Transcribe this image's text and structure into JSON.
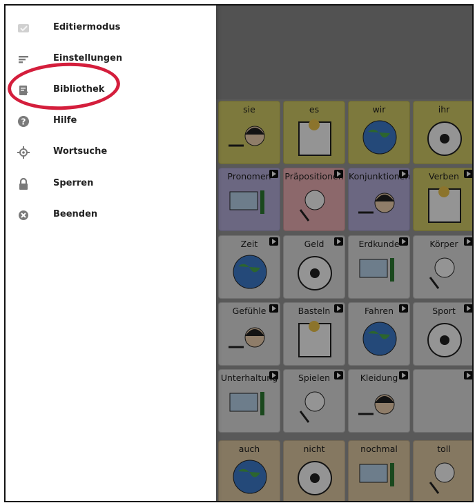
{
  "drawer": {
    "items": [
      {
        "label": "Editiermodus",
        "icon": "edit-mode-icon"
      },
      {
        "label": "Einstellungen",
        "icon": "settings-icon"
      },
      {
        "label": "Bibliothek",
        "icon": "library-icon"
      },
      {
        "label": "Hilfe",
        "icon": "help-icon"
      },
      {
        "label": "Wortsuche",
        "icon": "word-search-icon"
      },
      {
        "label": "Sperren",
        "icon": "lock-icon"
      },
      {
        "label": "Beenden",
        "icon": "close-icon"
      }
    ],
    "highlighted_item": "Bibliothek"
  },
  "board": {
    "rows": [
      [
        {
          "label": "sie",
          "color": "#d8d06a"
        },
        {
          "label": "es",
          "color": "#d8d06a"
        },
        {
          "label": "wir",
          "color": "#d8d06a"
        },
        {
          "label": "ihr",
          "color": "#d8d06a"
        }
      ],
      [
        {
          "label": "Pronomen",
          "color": "#b8b2de"
        },
        {
          "label": "Präpositionen",
          "color": "#f2b3b8"
        },
        {
          "label": "Konjunktionen",
          "color": "#b8b2de"
        },
        {
          "label": "Verben",
          "color": "#d8d06a"
        }
      ],
      [
        {
          "label": "Zeit",
          "color": "#e4e4e4"
        },
        {
          "label": "Geld",
          "color": "#e4e4e4"
        },
        {
          "label": "Erdkunde",
          "color": "#e4e4e4"
        },
        {
          "label": "Körper",
          "color": "#e4e4e4"
        }
      ],
      [
        {
          "label": "Gefühle",
          "color": "#e4e4e4"
        },
        {
          "label": "Basteln",
          "color": "#e4e4e4"
        },
        {
          "label": "Fahren",
          "color": "#e4e4e4"
        },
        {
          "label": "Sport",
          "color": "#e4e4e4"
        }
      ],
      [
        {
          "label": "Unterhaltung",
          "color": "#e4e4e4"
        },
        {
          "label": "Spielen",
          "color": "#e4e4e4"
        },
        {
          "label": "Kleidung",
          "color": "#e4e4e4"
        },
        {
          "label": "",
          "color": "#e4e4e4"
        }
      ],
      [
        {
          "label": "auch",
          "color": "#e6cfa8"
        },
        {
          "label": "nicht",
          "color": "#e6cfa8"
        },
        {
          "label": "nochmal",
          "color": "#e6cfa8"
        },
        {
          "label": "toll",
          "color": "#e6cfa8"
        }
      ]
    ]
  },
  "colors": {
    "highlight": "#d41e3c",
    "drawer_bg": "#ffffff",
    "overlay": "#000000"
  }
}
